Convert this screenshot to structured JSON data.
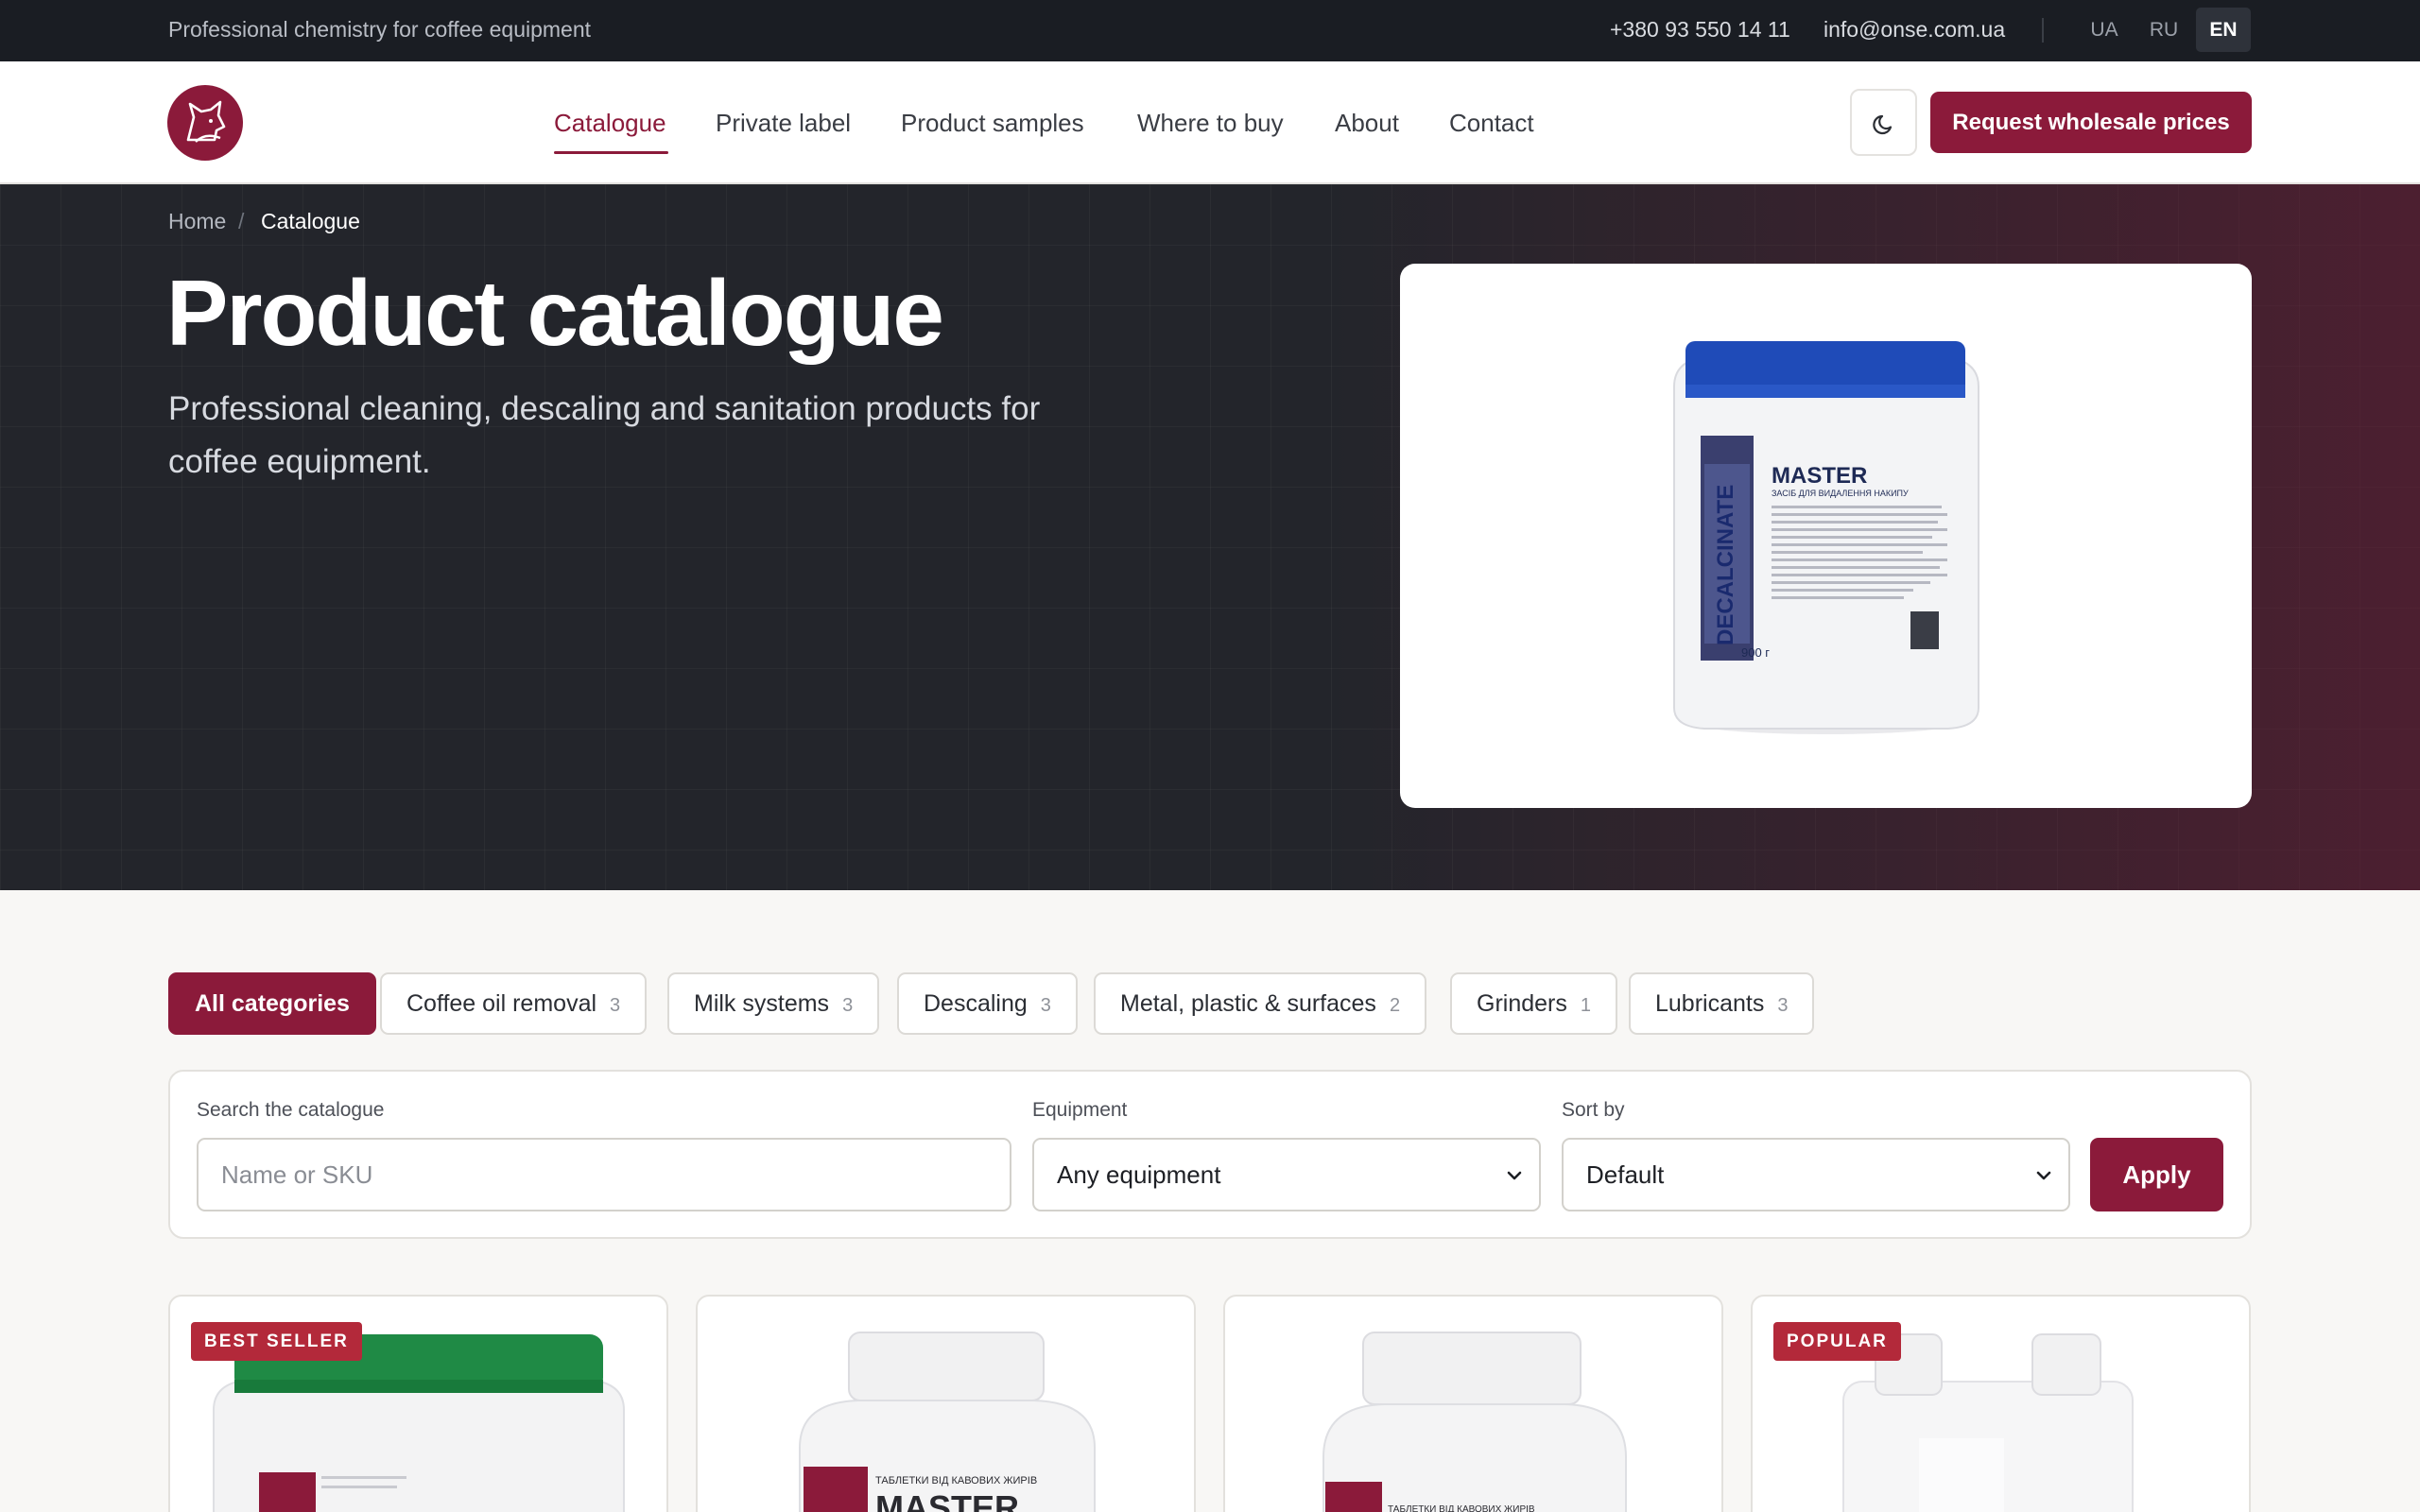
{
  "topbar": {
    "tagline": "Professional chemistry for coffee equipment",
    "phone": "+380 93 550 14 11",
    "email": "info@onse.com.ua",
    "languages": [
      "UA",
      "RU",
      "EN"
    ],
    "active_language": "EN"
  },
  "header": {
    "nav": [
      "Catalogue",
      "Private label",
      "Product samples",
      "Where to buy",
      "About",
      "Contact"
    ],
    "active_nav": "Catalogue",
    "cta": "Request wholesale prices"
  },
  "hero": {
    "breadcrumb": {
      "home": "Home",
      "separator": "/",
      "current": "Catalogue"
    },
    "title": "Product catalogue",
    "subtitle": "Professional cleaning, descaling and sanitation products for coffee equipment.",
    "product": {
      "vertical_label": "DECALCINATE",
      "brand": "MASTER",
      "subtitle_ua": "ЗАСІБ ДЛЯ ВИДАЛЕННЯ НАКИПУ",
      "weight": "900 г"
    }
  },
  "categories": [
    {
      "label": "All categories",
      "count": ""
    },
    {
      "label": "Coffee oil removal",
      "count": "3"
    },
    {
      "label": "Milk systems",
      "count": "3"
    },
    {
      "label": "Descaling",
      "count": "3"
    },
    {
      "label": "Metal, plastic & surfaces",
      "count": "2"
    },
    {
      "label": "Grinders",
      "count": "1"
    },
    {
      "label": "Lubricants",
      "count": "3"
    }
  ],
  "filters": {
    "search_label": "Search the catalogue",
    "search_placeholder": "Name or SKU",
    "equipment_label": "Equipment",
    "equipment_value": "Any equipment",
    "sort_label": "Sort by",
    "sort_value": "Default",
    "apply": "Apply"
  },
  "products": [
    {
      "badge": "BEST SELLER",
      "lid_color": "#1f8a45"
    },
    {
      "badge": "",
      "lid_color": "#f1f1f1",
      "label_text": "ТАБЛЕТКИ ВІД КАВОВИХ ЖИРІВ",
      "brand": "MASTER"
    },
    {
      "badge": "",
      "lid_color": "#f1f1f1",
      "label_text": "ТАБЛЕТКИ ВІД КАВОВИХ ЖИРІВ"
    },
    {
      "badge": "POPULAR",
      "lid_color": "#f1f1f1"
    }
  ],
  "colors": {
    "brand": "#8b1a3a",
    "badge": "#b3293a",
    "dark": "#1a1d23"
  }
}
